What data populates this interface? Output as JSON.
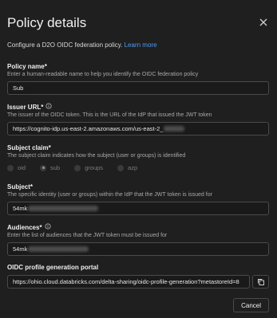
{
  "dialog": {
    "title": "Policy details",
    "description": "Configure a D2O OIDC federation policy.",
    "learn_more": "Learn more"
  },
  "fields": {
    "policy_name": {
      "label": "Policy name*",
      "hint": "Enter a human-readable name to help you identify the OIDC federation policy",
      "value": "Sub"
    },
    "issuer_url": {
      "label": "Issuer URL*",
      "hint": "The issuer of the OIDC token. This is the URL of the IdP that issued the JWT token",
      "value": "https://cognito-idp.us-east-2.amazonaws.com/us-east-2_"
    },
    "subject_claim": {
      "label": "Subject claim*",
      "hint": "The subject claim indicates how the subject (user or groups) is identified",
      "options": [
        "oid",
        "sub",
        "groups",
        "azp"
      ],
      "selected": "sub"
    },
    "subject": {
      "label": "Subject*",
      "hint": "The specific identity (user or groups) within the IdP that the JWT token is issued for",
      "value": "54mk"
    },
    "audiences": {
      "label": "Audiences*",
      "hint": "Enter the list of audiences that the JWT token must be issued for",
      "value": "54mk"
    },
    "oidc_portal": {
      "label": "OIDC profile generation portal",
      "value": "https://ohio.cloud.databricks.com/delta-sharing/oidc-profile-generation?metastoreId=8"
    }
  },
  "footer": {
    "cancel_label": "Cancel"
  },
  "icons": [
    "close-icon",
    "info-icon",
    "copy-icon"
  ],
  "colors": {
    "link": "#4d9df0",
    "background": "#1f1f1f"
  }
}
